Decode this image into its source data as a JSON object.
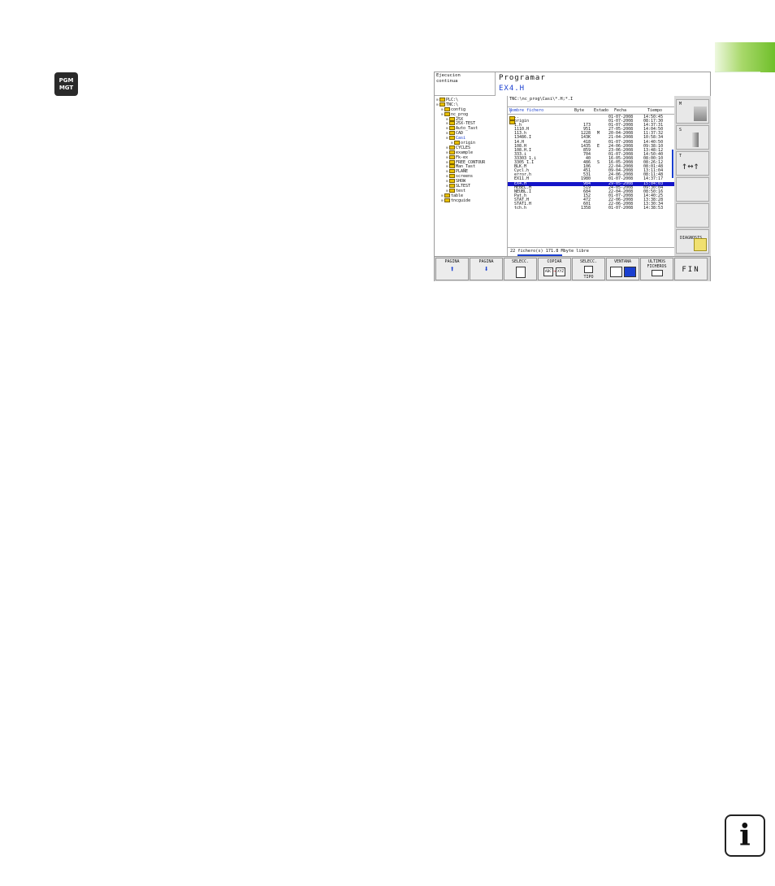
{
  "pgm_key": {
    "line1": "PGM",
    "line2": "MGT"
  },
  "info_key": {
    "glyph": "i"
  },
  "header": {
    "mode_line1": "Ejecucion",
    "mode_line2": "continua",
    "title": "Programar",
    "program": "EX4.H"
  },
  "tree": [
    {
      "label": "PLC:\\",
      "indent": 0
    },
    {
      "label": "TNC:\\",
      "indent": 0
    },
    {
      "label": "config",
      "indent": 1
    },
    {
      "label": "nc_prog",
      "indent": 1
    },
    {
      "label": "25X",
      "indent": 2
    },
    {
      "label": "25X-TEST",
      "indent": 2
    },
    {
      "label": "Auto_Tast",
      "indent": 2
    },
    {
      "label": "CAD",
      "indent": 2
    },
    {
      "label": "Casi",
      "indent": 2,
      "selected": true
    },
    {
      "label": "origin",
      "indent": 3
    },
    {
      "label": "CYCLES",
      "indent": 2
    },
    {
      "label": "example",
      "indent": 2
    },
    {
      "label": "Fk-ex",
      "indent": 2
    },
    {
      "label": "FREE_CONTOUR",
      "indent": 2
    },
    {
      "label": "Man_Tast",
      "indent": 2
    },
    {
      "label": "PLANE",
      "indent": 2
    },
    {
      "label": "screens",
      "indent": 2
    },
    {
      "label": "SHOW",
      "indent": 2
    },
    {
      "label": "SLTEST",
      "indent": 2
    },
    {
      "label": "test",
      "indent": 2
    },
    {
      "label": "table",
      "indent": 1
    },
    {
      "label": "tncguide",
      "indent": 1
    }
  ],
  "files": {
    "path": "TNC:\\nc_prog\\Casi\\*.H;*.I",
    "columns": {
      "name": "Nombre fichero",
      "bytes": "Byte",
      "status": "Estado",
      "date": "Fecha",
      "time": "Tiempo"
    },
    "rows": [
      {
        "name": "..",
        "bytes": "",
        "status": "",
        "date": "01-07-2008",
        "time": "14:50:45",
        "folder": true
      },
      {
        "name": "origin",
        "bytes": "",
        "status": "",
        "date": "01-07-2008",
        "time": "08:17:30",
        "folder": true
      },
      {
        "name": "1.h",
        "bytes": "173",
        "status": "",
        "date": "01-07-2008",
        "time": "14:37:31"
      },
      {
        "name": "1110.H",
        "bytes": "951",
        "status": "",
        "date": "27-05-2008",
        "time": "14:04:50"
      },
      {
        "name": "113.h",
        "bytes": "1228",
        "status": "M",
        "date": "20-04-2008",
        "time": "11:37:32"
      },
      {
        "name": "13486.I",
        "bytes": "143K",
        "status": "",
        "date": "21-04-2008",
        "time": "10:58:34"
      },
      {
        "name": "14.H",
        "bytes": "418",
        "status": "",
        "date": "01-07-2008",
        "time": "14:40:50"
      },
      {
        "name": "108.H",
        "bytes": "1435",
        "status": "E",
        "date": "24-06-2008",
        "time": "09:38:10"
      },
      {
        "name": "108.H.I",
        "bytes": "859",
        "status": "",
        "date": "23-06-2008",
        "time": "13:48:12"
      },
      {
        "name": "333.i",
        "bytes": "704",
        "status": "",
        "date": "01-07-2008",
        "time": "14:50:40"
      },
      {
        "name": "33303_1.i",
        "bytes": "40",
        "status": "",
        "date": "16-05-2008",
        "time": "08:00:10"
      },
      {
        "name": "3305_1.I",
        "bytes": "486",
        "status": "S",
        "date": "16-05-2008",
        "time": "08:26:12"
      },
      {
        "name": "BLK.H",
        "bytes": "106",
        "status": "",
        "date": "22-04-2008",
        "time": "08:01:48"
      },
      {
        "name": "Cycl.h",
        "bytes": "451",
        "status": "",
        "date": "09-04-2008",
        "time": "13:11:04"
      },
      {
        "name": "error.h",
        "bytes": "531",
        "status": "",
        "date": "24-06-2008",
        "time": "08:11:48"
      },
      {
        "name": "EX11.H",
        "bytes": "1980",
        "status": "",
        "date": "01-07-2008",
        "time": "14:37:17"
      },
      {
        "name": "EX4.H",
        "bytes": "984",
        "status": "",
        "date": "29-05-2008",
        "time": "15:04:03",
        "highlight": true
      },
      {
        "name": "HEBEL.H",
        "bytes": "519",
        "status": "",
        "date": "24-05-2008",
        "time": "09:30:04"
      },
      {
        "name": "NEUBL.I",
        "bytes": "684",
        "status": "",
        "date": "22-04-2008",
        "time": "08:50:16"
      },
      {
        "name": "Pat.h",
        "bytes": "152",
        "status": "",
        "date": "01-07-2008",
        "time": "14:40:25"
      },
      {
        "name": "STAT.H",
        "bytes": "472",
        "status": "",
        "date": "22-06-2008",
        "time": "13:38:28"
      },
      {
        "name": "STAT1.H",
        "bytes": "601",
        "status": "",
        "date": "22-06-2008",
        "time": "13:30:34"
      },
      {
        "name": "tch.h",
        "bytes": "1358",
        "status": "",
        "date": "01-07-2008",
        "time": "14:38:53"
      }
    ],
    "footer": "22  fichero(s)  171.8 Mbyte libre"
  },
  "side_softkeys": [
    {
      "label": "M",
      "pic": "machine"
    },
    {
      "label": "S",
      "pic": "spindle"
    },
    {
      "label": "T",
      "pic": "arrows"
    },
    {
      "label": "",
      "pic": ""
    },
    {
      "label": "",
      "pic": ""
    },
    {
      "label": "DIAGNOSIS",
      "pic": "doc"
    }
  ],
  "softkeys": [
    {
      "label": "PAGINA",
      "icon": "up"
    },
    {
      "label": "PAGINA",
      "icon": "down"
    },
    {
      "label": "SELECC.",
      "icon": "doc"
    },
    {
      "label": "COPIAR",
      "icon": "copy",
      "abc": "ABC",
      "xyz": "XYZ"
    },
    {
      "label": "SELECC.",
      "icon": "tipo",
      "sub": "TIPO"
    },
    {
      "label": "VENTANA",
      "icon": "window"
    },
    {
      "label": "ULTIMOS\nFICHEROS",
      "icon": "recent"
    },
    {
      "label": "FIN",
      "icon": "fin"
    }
  ],
  "colors": {
    "accent_green": "#6fbf2a",
    "highlight_blue": "#1414c8",
    "text_blue": "#1a3fd0"
  }
}
